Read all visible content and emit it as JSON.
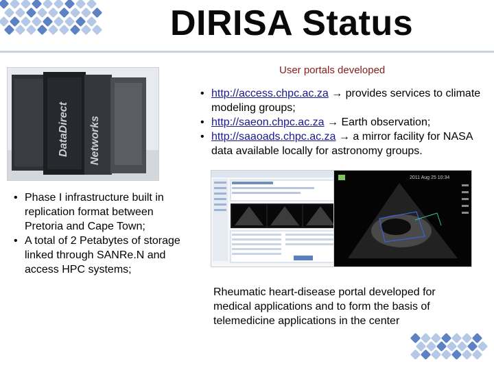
{
  "slide": {
    "title": "DIRISA Status",
    "subtitle": "User portals developed",
    "portals": [
      {
        "link": "http://access.chpc.ac.za",
        "arrow": "→",
        "text": " provides services to climate modeling groups;"
      },
      {
        "link": "http://saeon.chpc.ac.za",
        "arrow": "→",
        "text": " Earth observation;"
      },
      {
        "link": "http://saaoads.chpc.ac.za",
        "arrow": "→",
        "text": " a mirror facility for NASA data available locally for astronomy groups."
      }
    ],
    "infrastructure": [
      "Phase I infrastructure built in replication format between Pretoria and Cape Town;",
      "A total of 2 Petabytes of storage linked through SANRe.N and access HPC systems;"
    ],
    "caption": "Rheumatic heart-disease portal developed for medical applications and to form the basis of telemedicine applications in the center",
    "bullet": "•"
  },
  "images": {
    "rack_brand_top": "DataDirect",
    "rack_brand_bottom": "Networks",
    "echo_header": "2011 Aug 25 10:34"
  },
  "colors": {
    "subtitle": "#8b1a1a",
    "link": "#1a1a8c",
    "logo_dot_light": "#b5c8e6",
    "logo_dot_dark": "#5c82c4"
  }
}
